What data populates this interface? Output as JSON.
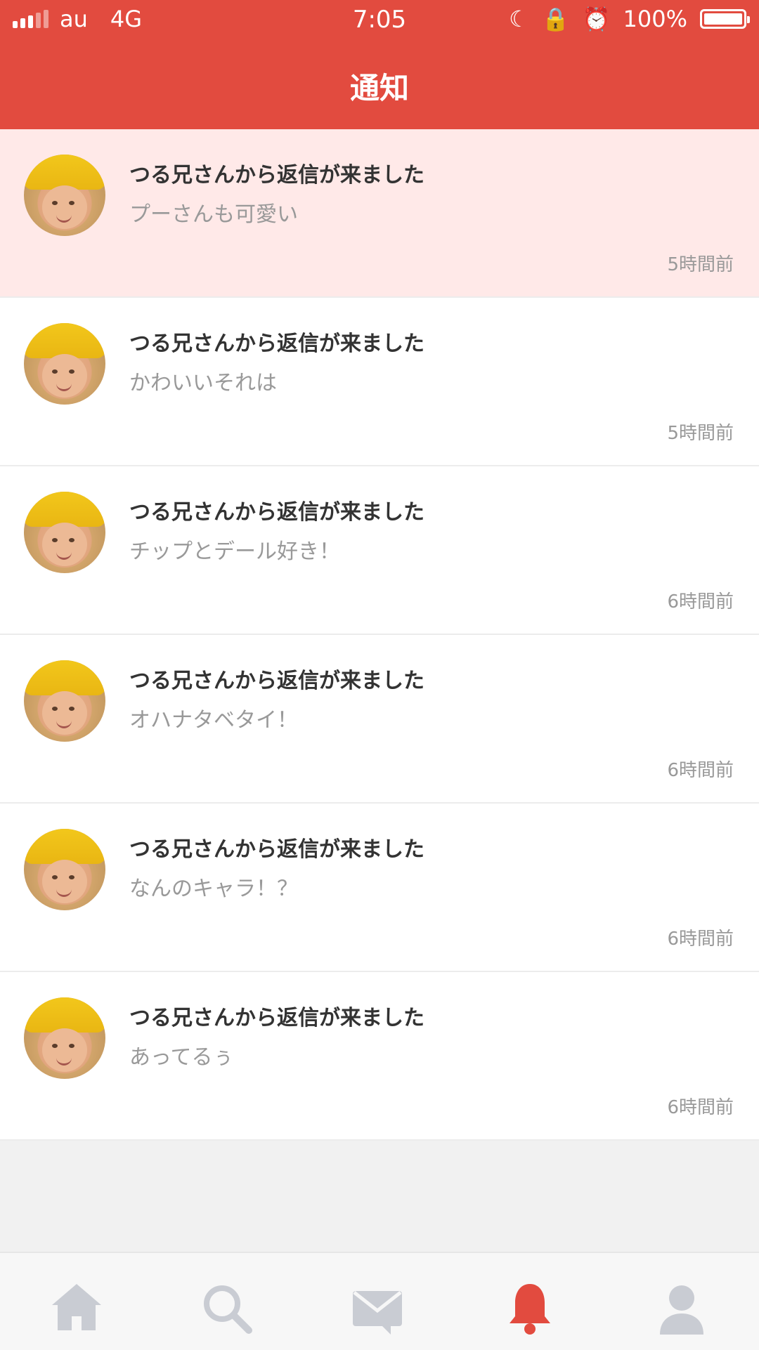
{
  "status_bar": {
    "carrier": "au",
    "network": "4G",
    "time": "7:05",
    "battery": "100%"
  },
  "header": {
    "title": "通知"
  },
  "notifications": [
    {
      "heading": "つる兄さんから返信が来ました",
      "message": "プーさんも可愛い",
      "time": "5時間前",
      "unread": true
    },
    {
      "heading": "つる兄さんから返信が来ました",
      "message": "かわいいそれは",
      "time": "5時間前",
      "unread": false
    },
    {
      "heading": "つる兄さんから返信が来ました",
      "message": "チップとデール好き！",
      "time": "6時間前",
      "unread": false
    },
    {
      "heading": "つる兄さんから返信が来ました",
      "message": "オハナタベタイ！",
      "time": "6時間前",
      "unread": false
    },
    {
      "heading": "つる兄さんから返信が来ました",
      "message": "なんのキャラ！？",
      "time": "6時間前",
      "unread": false
    },
    {
      "heading": "つる兄さんから返信が来ました",
      "message": "あってるぅ",
      "time": "6時間前",
      "unread": false
    }
  ],
  "tabbar": {
    "items": [
      {
        "icon": "home-icon",
        "active": false
      },
      {
        "icon": "search-icon",
        "active": false
      },
      {
        "icon": "mail-icon",
        "active": false
      },
      {
        "icon": "bell-icon",
        "active": true
      },
      {
        "icon": "user-icon",
        "active": false
      }
    ],
    "active_color": "#e24b3f",
    "inactive_color": "#c9ccd3"
  },
  "colors": {
    "header_bg": "#e24b3f",
    "unread_bg": "#ffe9e8"
  }
}
